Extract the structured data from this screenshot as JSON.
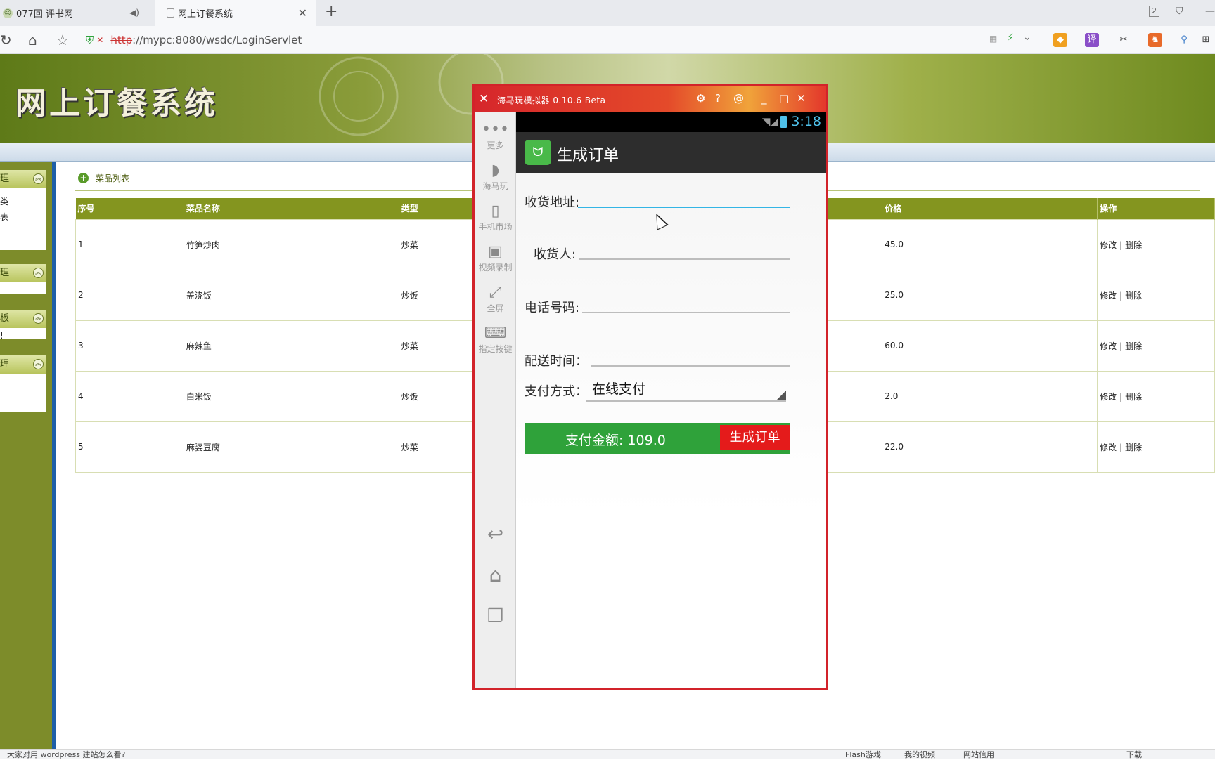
{
  "browser": {
    "tabs": [
      {
        "label": "077回 评书网"
      },
      {
        "label": "网上订餐系统"
      }
    ],
    "new_tab": "+",
    "tab_count": "2",
    "url_scheme": "http",
    "url_rest": "://mypc:8080/wsdc/LoginServlet",
    "status_left": "大家对用 wordpress 建站怎么看?",
    "status_right": [
      "Flash游戏",
      "我的视频",
      "网站信用",
      "下载"
    ]
  },
  "site": {
    "title": "网上订餐系统",
    "sidebar_groups": [
      {
        "head": "理",
        "items": [
          "类",
          "表"
        ]
      },
      {
        "head": "理",
        "items": []
      },
      {
        "head": "板",
        "items": [
          "!"
        ]
      },
      {
        "head": "理",
        "items": []
      }
    ],
    "list_title": "菜品列表",
    "table": {
      "headers": [
        "序号",
        "菜品名称",
        "类型",
        "",
        "价格",
        "操作"
      ],
      "rows": [
        {
          "id": "1",
          "name": "竹笋炒肉",
          "type": "炒菜",
          "price": "45.0",
          "edit": "修改",
          "sep": "|",
          "del": "删除"
        },
        {
          "id": "2",
          "name": "盖浇饭",
          "type": "炒饭",
          "price": "25.0",
          "edit": "修改",
          "sep": "|",
          "del": "删除"
        },
        {
          "id": "3",
          "name": "麻辣鱼",
          "type": "炒菜",
          "price": "60.0",
          "edit": "修改",
          "sep": "|",
          "del": "删除"
        },
        {
          "id": "4",
          "name": "白米饭",
          "type": "炒饭",
          "price": "2.0",
          "edit": "修改",
          "sep": "|",
          "del": "删除"
        },
        {
          "id": "5",
          "name": "麻婆豆腐",
          "type": "炒菜",
          "price": "22.0",
          "edit": "修改",
          "sep": "|",
          "del": "删除"
        }
      ]
    }
  },
  "emulator": {
    "title": "海马玩模拟器 0.10.6 Beta",
    "side_items": [
      "更多",
      "海马玩",
      "手机市场",
      "视频录制",
      "全屏",
      "指定按键"
    ],
    "clock": "3:18",
    "app_title": "生成订单",
    "form": {
      "address_label": "收货地址:",
      "receiver_label": "收货人:",
      "phone_label": "电话号码:",
      "time_label": "配送时间：",
      "pay_method_label": "支付方式：",
      "pay_method_value": "在线支付",
      "amount_label": "支付金额:",
      "amount_value": "109.0",
      "submit_label": "生成订单"
    }
  },
  "colors": {
    "banner_green": "#7d8c2a",
    "table_header": "#84951f",
    "emulator_red": "#d2232a",
    "pay_bar_green": "#2fa23a",
    "submit_red": "#e41b1b",
    "accent_blue": "#33b5e5"
  }
}
